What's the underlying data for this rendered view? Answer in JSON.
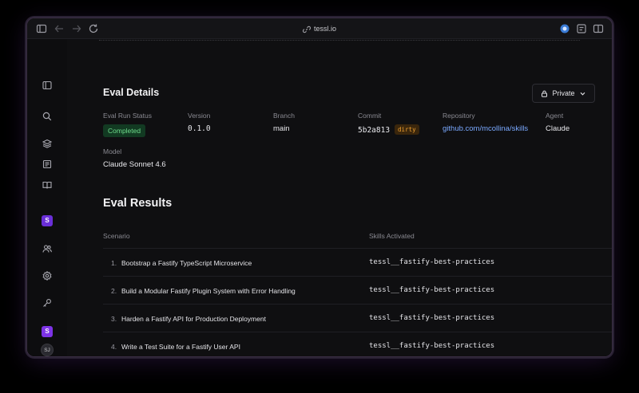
{
  "browser": {
    "url": "tessl.io"
  },
  "sidebar": {
    "workspace_initial": "S",
    "workspace2_initial": "S",
    "user_initials": "SJ"
  },
  "eval_details": {
    "title": "Eval Details",
    "visibility_button": "Private",
    "fields": {
      "status_label": "Eval Run Status",
      "status_value": "Completed",
      "version_label": "Version",
      "version_value": "0.1.0",
      "branch_label": "Branch",
      "branch_value": "main",
      "commit_label": "Commit",
      "commit_value": "5b2a813",
      "commit_badge": "dirty",
      "repository_label": "Repository",
      "repository_value": "github.com/mcollina/skills",
      "agent_label": "Agent",
      "agent_value": "Claude",
      "model_label": "Model",
      "model_value": "Claude Sonnet 4.6"
    }
  },
  "eval_results": {
    "title": "Eval Results",
    "columns": [
      "Scenario",
      "Skills Activated"
    ],
    "rows": [
      {
        "num": "1.",
        "scenario": "Bootstrap a Fastify TypeScript Microservice",
        "skill": "tessl__fastify-best-practices"
      },
      {
        "num": "2.",
        "scenario": "Build a Modular Fastify Plugin System with Error Handling",
        "skill": "tessl__fastify-best-practices"
      },
      {
        "num": "3.",
        "scenario": "Harden a Fastify API for Production Deployment",
        "skill": "tessl__fastify-best-practices"
      },
      {
        "num": "4.",
        "scenario": "Write a Test Suite for a Fastify User API",
        "skill": "tessl__fastify-best-practices"
      }
    ]
  },
  "colors": {
    "accent_purple": "#6a2fd8",
    "status_green": "#6fdc8c",
    "dirty_orange": "#f0a030",
    "link_blue": "#7aa9ff"
  }
}
